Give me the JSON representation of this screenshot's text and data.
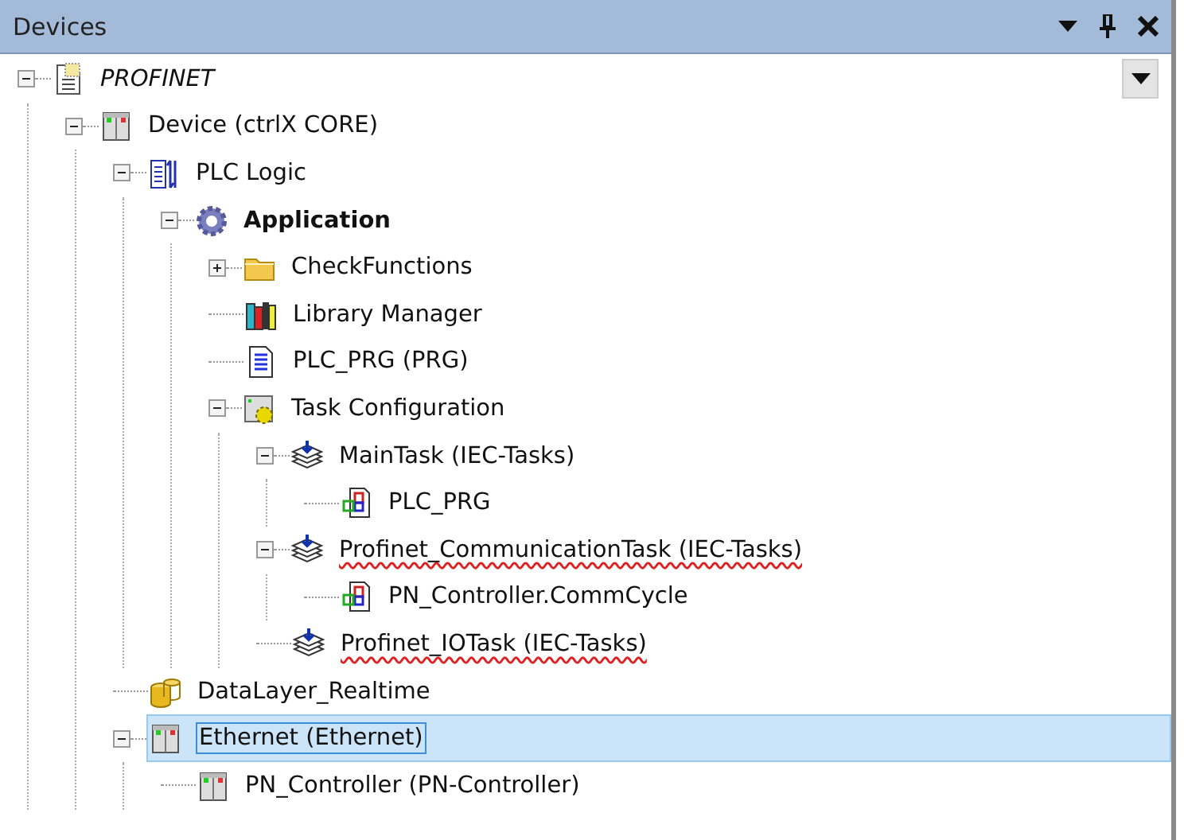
{
  "panel": {
    "title": "Devices"
  },
  "tree": [
    {
      "label": "PROFINET",
      "kind": "project",
      "misspelled": false,
      "selected": false,
      "expanded": true,
      "children": [
        {
          "label": "Device (ctrlX CORE)",
          "kind": "device",
          "misspelled": false,
          "selected": false,
          "expanded": true,
          "children": [
            {
              "label": "PLC Logic",
              "kind": "plc",
              "misspelled": false,
              "selected": false,
              "expanded": true,
              "children": [
                {
                  "label": "Application",
                  "kind": "application",
                  "misspelled": false,
                  "selected": false,
                  "expanded": true,
                  "children": [
                    {
                      "label": "CheckFunctions",
                      "kind": "folder",
                      "misspelled": false,
                      "selected": false,
                      "expanded": false
                    },
                    {
                      "label": "Library Manager",
                      "kind": "library",
                      "misspelled": false,
                      "selected": false
                    },
                    {
                      "label": "PLC_PRG (PRG)",
                      "kind": "program",
                      "misspelled": false,
                      "selected": false
                    },
                    {
                      "label": "Task Configuration",
                      "kind": "taskconfig",
                      "misspelled": false,
                      "selected": false,
                      "expanded": true,
                      "children": [
                        {
                          "label": "MainTask (IEC-Tasks)",
                          "kind": "task",
                          "misspelled": false,
                          "selected": false,
                          "expanded": true,
                          "children": [
                            {
                              "label": "PLC_PRG",
                              "kind": "call",
                              "misspelled": false,
                              "selected": false
                            }
                          ]
                        },
                        {
                          "label": "Profinet_CommunicationTask (IEC-Tasks)",
                          "kind": "task",
                          "misspelled": true,
                          "selected": false,
                          "expanded": true,
                          "children": [
                            {
                              "label": "PN_Controller.CommCycle",
                              "kind": "call",
                              "misspelled": false,
                              "selected": false
                            }
                          ]
                        },
                        {
                          "label": "Profinet_IOTask (IEC-Tasks)",
                          "kind": "task",
                          "misspelled": true,
                          "selected": false
                        }
                      ]
                    }
                  ]
                }
              ]
            },
            {
              "label": "DataLayer_Realtime",
              "kind": "database",
              "misspelled": false,
              "selected": false
            },
            {
              "label": "Ethernet (Ethernet)",
              "kind": "device",
              "misspelled": false,
              "selected": true,
              "expanded": true,
              "children": [
                {
                  "label": "PN_Controller (PN-Controller)",
                  "kind": "device",
                  "misspelled": false,
                  "selected": false
                }
              ]
            }
          ]
        }
      ]
    }
  ]
}
